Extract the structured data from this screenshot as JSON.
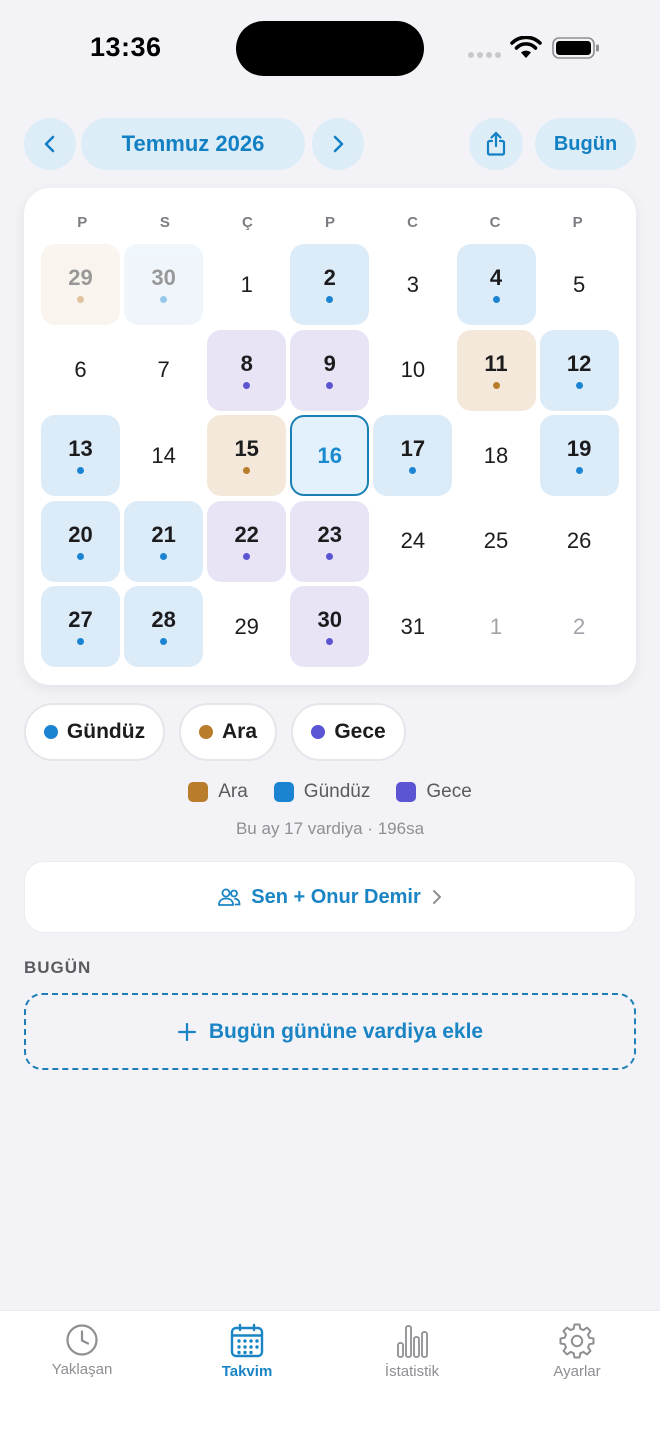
{
  "status": {
    "time": "13:36"
  },
  "header": {
    "month_label": "Temmuz 2026",
    "today_label": "Bugün",
    "prev_icon": "chevron-left-icon",
    "next_icon": "chevron-right-icon",
    "share_icon": "share-icon"
  },
  "calendar": {
    "weekdays": [
      "P",
      "S",
      "Ç",
      "P",
      "C",
      "C",
      "P"
    ],
    "weeks": [
      [
        {
          "day": "29",
          "type": "ara",
          "other": true
        },
        {
          "day": "30",
          "type": "day",
          "other": true
        },
        {
          "day": "1"
        },
        {
          "day": "2",
          "type": "day"
        },
        {
          "day": "3"
        },
        {
          "day": "4",
          "type": "day"
        },
        {
          "day": "5"
        }
      ],
      [
        {
          "day": "6"
        },
        {
          "day": "7"
        },
        {
          "day": "8",
          "type": "night"
        },
        {
          "day": "9",
          "type": "night"
        },
        {
          "day": "10"
        },
        {
          "day": "11",
          "type": "ara"
        },
        {
          "day": "12",
          "type": "day"
        }
      ],
      [
        {
          "day": "13",
          "type": "day"
        },
        {
          "day": "14"
        },
        {
          "day": "15",
          "type": "ara"
        },
        {
          "day": "16",
          "today": true
        },
        {
          "day": "17",
          "type": "day"
        },
        {
          "day": "18"
        },
        {
          "day": "19",
          "type": "day"
        }
      ],
      [
        {
          "day": "20",
          "type": "day"
        },
        {
          "day": "21",
          "type": "day"
        },
        {
          "day": "22",
          "type": "night"
        },
        {
          "day": "23",
          "type": "night"
        },
        {
          "day": "24"
        },
        {
          "day": "25"
        },
        {
          "day": "26"
        }
      ],
      [
        {
          "day": "27",
          "type": "day"
        },
        {
          "day": "28",
          "type": "day"
        },
        {
          "day": "29"
        },
        {
          "day": "30",
          "type": "night"
        },
        {
          "day": "31"
        },
        {
          "day": "1",
          "muted": true
        },
        {
          "day": "2",
          "muted": true
        }
      ]
    ]
  },
  "colors": {
    "day": "#1a84d2",
    "ara": "#b87c2a",
    "night": "#5b55d4",
    "accent": "#1a84c4"
  },
  "filters": [
    {
      "label": "Gündüz",
      "type": "day"
    },
    {
      "label": "Ara",
      "type": "ara"
    },
    {
      "label": "Gece",
      "type": "night"
    }
  ],
  "legend": [
    {
      "label": "Ara",
      "type": "ara"
    },
    {
      "label": "Gündüz",
      "type": "day"
    },
    {
      "label": "Gece",
      "type": "night"
    }
  ],
  "summary": "Bu ay 17 vardiya · 196sa",
  "partner": {
    "label": "Sen + Onur Demir",
    "icon": "people-icon"
  },
  "today_section": {
    "title": "BUGÜN",
    "add_label": "Bugün gününe vardiya ekle"
  },
  "tabs": [
    {
      "label": "Yaklaşan",
      "icon": "clock-icon",
      "active": false
    },
    {
      "label": "Takvim",
      "icon": "calendar-icon",
      "active": true
    },
    {
      "label": "İstatistik",
      "icon": "bar-chart-icon",
      "active": false
    },
    {
      "label": "Ayarlar",
      "icon": "gear-icon",
      "active": false
    }
  ]
}
